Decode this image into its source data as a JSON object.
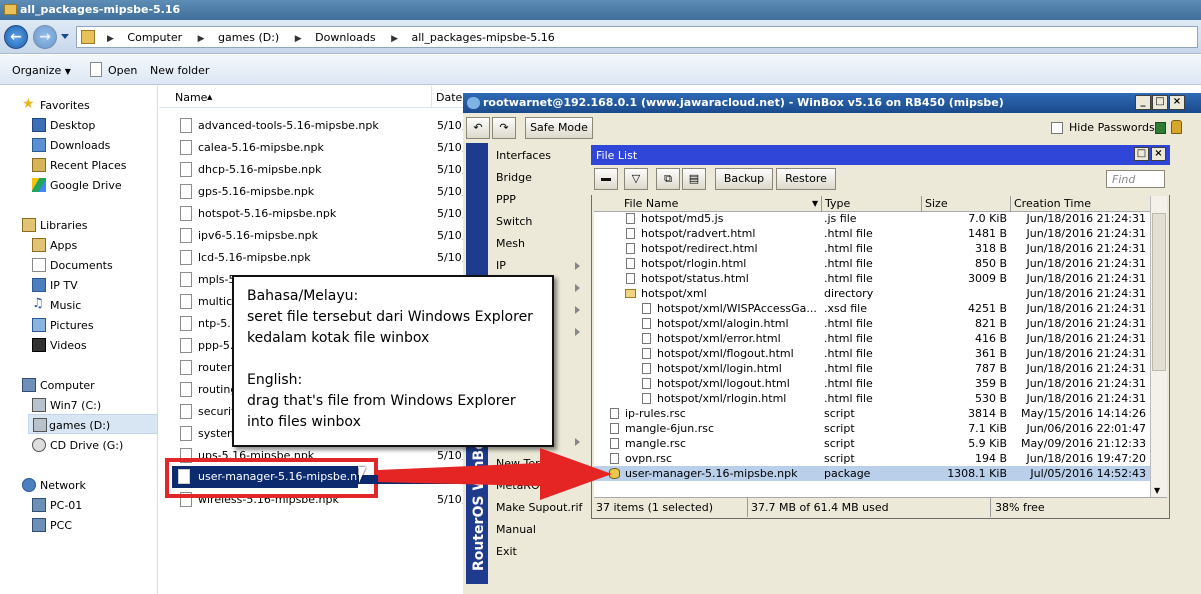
{
  "explorer": {
    "title": "all_packages-mipsbe-5.16",
    "breadcrumbs": [
      "Computer",
      "games (D:)",
      "Downloads",
      "all_packages-mipsbe-5.16"
    ],
    "commands": {
      "organize": "Organize",
      "open": "Open",
      "new_folder": "New folder"
    },
    "nav": {
      "favorites": "Favorites",
      "favorites_items": [
        "Desktop",
        "Downloads",
        "Recent Places",
        "Google Drive"
      ],
      "libraries": "Libraries",
      "libraries_items": [
        "Apps",
        "Documents",
        "IP TV",
        "Music",
        "Pictures",
        "Videos"
      ],
      "computer": "Computer",
      "computer_items": [
        "Win7 (C:)",
        "games (D:)",
        "CD Drive (G:)"
      ],
      "network": "Network",
      "network_items": [
        "PC-01",
        "PCC"
      ]
    },
    "columns": {
      "name": "Name",
      "date": "Date"
    },
    "files": [
      {
        "name": "advanced-tools-5.16-mipsbe.npk",
        "date": "5/10,"
      },
      {
        "name": "calea-5.16-mipsbe.npk",
        "date": "5/10,"
      },
      {
        "name": "dhcp-5.16-mipsbe.npk",
        "date": "5/10,"
      },
      {
        "name": "gps-5.16-mipsbe.npk",
        "date": "5/10,"
      },
      {
        "name": "hotspot-5.16-mipsbe.npk",
        "date": "5/10,"
      },
      {
        "name": "ipv6-5.16-mipsbe.npk",
        "date": "5/10,"
      },
      {
        "name": "lcd-5.16-mipsbe.npk",
        "date": "5/10,"
      },
      {
        "name": "mpls-5",
        "date": ""
      },
      {
        "name": "multica",
        "date": ""
      },
      {
        "name": "ntp-5.",
        "date": ""
      },
      {
        "name": "ppp-5.",
        "date": ""
      },
      {
        "name": "routerl",
        "date": ""
      },
      {
        "name": "routing",
        "date": ""
      },
      {
        "name": "securit",
        "date": ""
      },
      {
        "name": "system",
        "date": ""
      },
      {
        "name": "ups-5.16-mipsbe.npk",
        "date": "5/10,"
      },
      {
        "name": "wireless-5.16-mipsbe.npk",
        "date": "5/10,"
      }
    ],
    "dragged_file": "user-manager-5.16-mipsbe.npk"
  },
  "winbox": {
    "title": "rootwarnet@192.168.0.1 (www.jawaracloud.net) - WinBox v5.16 on RB450 (mipsbe)",
    "safe_mode": "Safe Mode",
    "hide_passwords": "Hide Passwords",
    "menu": [
      "Interfaces",
      "Bridge",
      "PPP",
      "Switch",
      "Mesh",
      "IP",
      "New Terminal",
      "MetaROUTER",
      "Make Supout.rif",
      "Manual",
      "Exit"
    ],
    "side_label": "RouterOS WinBox",
    "file_list": {
      "title": "File List",
      "backup": "Backup",
      "restore": "Restore",
      "find_placeholder": "Find",
      "columns": [
        "File Name",
        "Type",
        "Size",
        "Creation Time"
      ],
      "rows": [
        {
          "name": "hotspot/md5.js",
          "type": ".js file",
          "size": "7.0 KiB",
          "time": "Jun/18/2016 21:24:31",
          "level": 1,
          "kind": "file"
        },
        {
          "name": "hotspot/radvert.html",
          "type": ".html file",
          "size": "1481 B",
          "time": "Jun/18/2016 21:24:31",
          "level": 1,
          "kind": "file"
        },
        {
          "name": "hotspot/redirect.html",
          "type": ".html file",
          "size": "318 B",
          "time": "Jun/18/2016 21:24:31",
          "level": 1,
          "kind": "file"
        },
        {
          "name": "hotspot/rlogin.html",
          "type": ".html file",
          "size": "850 B",
          "time": "Jun/18/2016 21:24:31",
          "level": 1,
          "kind": "file"
        },
        {
          "name": "hotspot/status.html",
          "type": ".html file",
          "size": "3009 B",
          "time": "Jun/18/2016 21:24:31",
          "level": 1,
          "kind": "file"
        },
        {
          "name": "hotspot/xml",
          "type": "directory",
          "size": "",
          "time": "Jun/18/2016 21:24:31",
          "level": 1,
          "kind": "folder"
        },
        {
          "name": "hotspot/xml/WISPAccessGa...",
          "type": ".xsd file",
          "size": "4251 B",
          "time": "Jun/18/2016 21:24:31",
          "level": 2,
          "kind": "file"
        },
        {
          "name": "hotspot/xml/alogin.html",
          "type": ".html file",
          "size": "821 B",
          "time": "Jun/18/2016 21:24:31",
          "level": 2,
          "kind": "file"
        },
        {
          "name": "hotspot/xml/error.html",
          "type": ".html file",
          "size": "416 B",
          "time": "Jun/18/2016 21:24:31",
          "level": 2,
          "kind": "file"
        },
        {
          "name": "hotspot/xml/flogout.html",
          "type": ".html file",
          "size": "361 B",
          "time": "Jun/18/2016 21:24:31",
          "level": 2,
          "kind": "file"
        },
        {
          "name": "hotspot/xml/login.html",
          "type": ".html file",
          "size": "787 B",
          "time": "Jun/18/2016 21:24:31",
          "level": 2,
          "kind": "file"
        },
        {
          "name": "hotspot/xml/logout.html",
          "type": ".html file",
          "size": "359 B",
          "time": "Jun/18/2016 21:24:31",
          "level": 2,
          "kind": "file"
        },
        {
          "name": "hotspot/xml/rlogin.html",
          "type": ".html file",
          "size": "530 B",
          "time": "Jun/18/2016 21:24:31",
          "level": 2,
          "kind": "file"
        },
        {
          "name": "ip-rules.rsc",
          "type": "script",
          "size": "3814 B",
          "time": "May/15/2016 14:14:26",
          "level": 0,
          "kind": "file"
        },
        {
          "name": "mangle-6jun.rsc",
          "type": "script",
          "size": "7.1 KiB",
          "time": "Jun/06/2016 22:01:47",
          "level": 0,
          "kind": "file"
        },
        {
          "name": "mangle.rsc",
          "type": "script",
          "size": "5.9 KiB",
          "time": "May/09/2016 21:12:33",
          "level": 0,
          "kind": "file"
        },
        {
          "name": "ovpn.rsc",
          "type": "script",
          "size": "194 B",
          "time": "Jun/18/2016 19:47:20",
          "level": 0,
          "kind": "file"
        },
        {
          "name": "user-manager-5.16-mipsbe.npk",
          "type": "package",
          "size": "1308.1 KiB",
          "time": "Jul/05/2016 14:52:43",
          "level": 0,
          "kind": "package",
          "selected": true
        }
      ],
      "status": {
        "items": "37 items (1 selected)",
        "usage": "37.7 MB of 61.4 MB used",
        "free": "38% free"
      }
    }
  },
  "annotation": {
    "line1": "Bahasa/Melayu:",
    "line2": "seret file tersebut dari Windows Explorer",
    "line3": "kedalam kotak file winbox",
    "line4": "English:",
    "line5": "drag that's file from Windows Explorer",
    "line6": "into files winbox"
  },
  "colors": {
    "highlight": "#e12727",
    "selection": "#0c2b6e",
    "winbox_side": "#1e3b8e",
    "file_list_title": "#3046d8"
  }
}
